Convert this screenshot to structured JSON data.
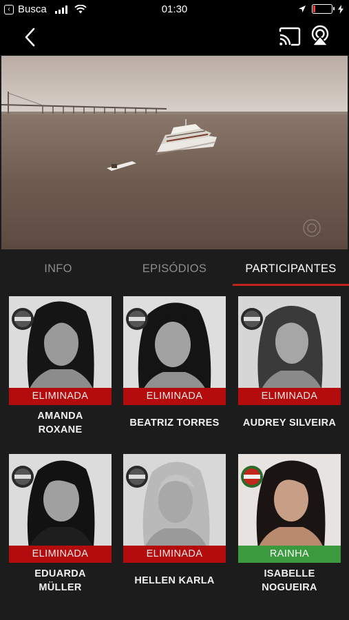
{
  "status_bar": {
    "back_app_label": "Busca",
    "time": "01:30",
    "battery_color": "#ff3b30"
  },
  "nav": {
    "icons": [
      "chevron-left-icon",
      "cast-icon",
      "airplay-icon"
    ]
  },
  "tabs": [
    {
      "label": "INFO",
      "active": false
    },
    {
      "label": "EPISÓDIOS",
      "active": false
    },
    {
      "label": "PARTICIPANTES",
      "active": true
    }
  ],
  "accent_color": "#c2231c",
  "participants": [
    {
      "name_line1": "AMANDA",
      "name_line2": "ROXANE",
      "status": "ELIMINADA",
      "status_color": "#b40c0c"
    },
    {
      "name_line1": "BEATRIZ TORRES",
      "name_line2": "",
      "status": "ELIMINADA",
      "status_color": "#b40c0c"
    },
    {
      "name_line1": "AUDREY SILVEIRA",
      "name_line2": "",
      "status": "ELIMINADA",
      "status_color": "#b40c0c"
    },
    {
      "name_line1": "EDUARDA",
      "name_line2": "MÜLLER",
      "status": "ELIMINADA",
      "status_color": "#b40c0c"
    },
    {
      "name_line1": "HELLEN KARLA",
      "name_line2": "",
      "status": "ELIMINADA",
      "status_color": "#b40c0c"
    },
    {
      "name_line1": "ISABELLE",
      "name_line2": "NOGUEIRA",
      "status": "RAINHA",
      "status_color": "#3b9a3d"
    }
  ]
}
